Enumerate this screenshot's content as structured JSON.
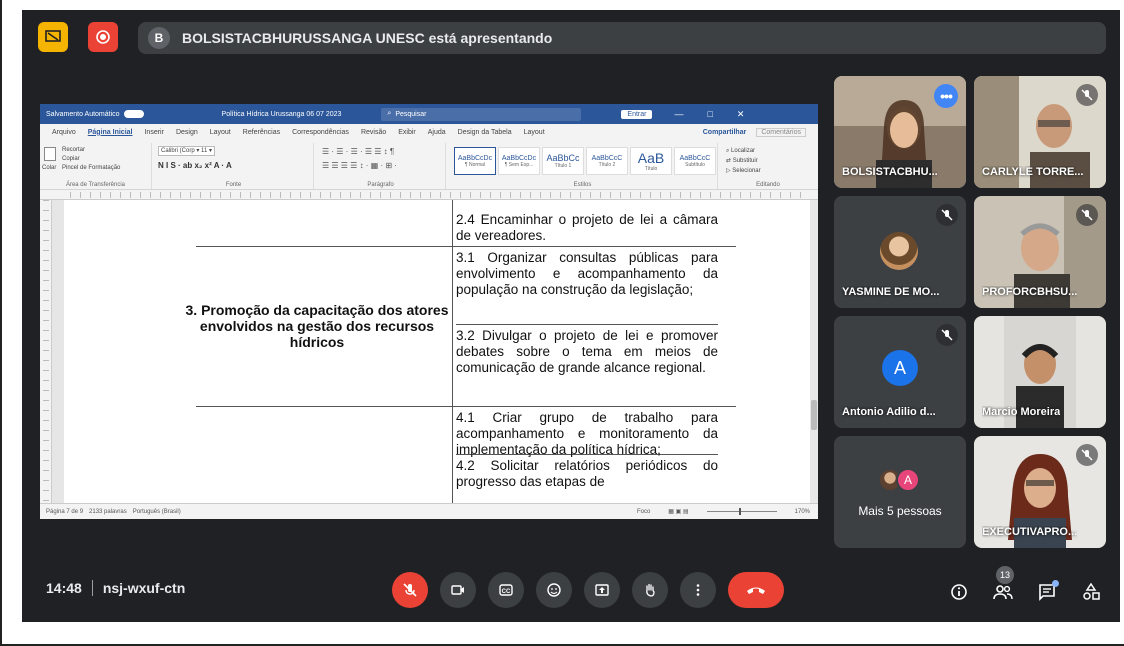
{
  "banner": {
    "avatar_letter": "B",
    "text": "BOLSISTACBHURUSSANGA UNESC está apresentando"
  },
  "word": {
    "autosave": "Salvamento Automático",
    "doc_title": "Política Hídrica Urussanga 06 07 2023",
    "search_placeholder": "Pesquisar",
    "signin": "Entrar",
    "window_controls": [
      "—",
      "□",
      "✕"
    ],
    "tabs": [
      "Arquivo",
      "Página Inicial",
      "Inserir",
      "Design",
      "Layout",
      "Referências",
      "Correspondências",
      "Revisão",
      "Exibir",
      "Ajuda",
      "Design da Tabela",
      "Layout"
    ],
    "share_label": "Compartilhar",
    "comments_label": "Comentários",
    "ribbon": {
      "clipboard": {
        "paste": "Colar",
        "items": [
          "Recortar",
          "Copiar",
          "Pincel de Formatação"
        ],
        "label": "Área de Transferência"
      },
      "font": {
        "name": "Calibri (Corp",
        "size": "11",
        "label": "Fonte",
        "formatting": "N I S · ab x₂ x² A · A"
      },
      "paragraph": {
        "label": "Parágrafo",
        "row1": "☰ · ☰ · ☰ · ☰ ☰ ↕ ¶",
        "row2": "☰ ☰ ☰ ☰ ↕ · ▦ · ⊞ ·"
      },
      "styles": {
        "label": "Estilos",
        "items": [
          {
            "sample": "AaBbCcDc",
            "name": "¶ Normal"
          },
          {
            "sample": "AaBbCcDc",
            "name": "¶ Sem Esp..."
          },
          {
            "sample": "AaBbCc",
            "name": "Título 1"
          },
          {
            "sample": "AaBbCcC",
            "name": "Título 2"
          },
          {
            "sample": "AaB",
            "name": "Título"
          },
          {
            "sample": "AaBbCcC",
            "name": "Subtítulo"
          }
        ]
      },
      "editing": {
        "label": "Editando",
        "items": [
          "Localizar",
          "Substituir",
          "Selecionar"
        ]
      }
    },
    "table": {
      "left_cell": "3. Promoção da capacitação dos atores envolvidos na gestão dos recursos hídricos",
      "items": [
        "2.4 Encaminhar o projeto de lei a câmara de vereadores.",
        "3.1 Organizar consultas públicas para envolvimento e acompanhamento da população na construção da legislação;",
        "3.2 Divulgar o projeto de lei e promover debates sobre o tema em meios de comunicação de grande alcance regional.",
        "4.1 Criar grupo de trabalho para acompanhamento e monitoramento da implementação da política hídrica;",
        "4.2 Solicitar relatórios periódicos do progresso das etapas de"
      ]
    },
    "status": {
      "page": "Página 7 de 9",
      "words": "2133 palavras",
      "language": "Português (Brasil)",
      "focus": "Foco",
      "zoom": "170%"
    }
  },
  "participants": [
    {
      "name": "BOLSISTACBHU...",
      "speaking": true,
      "kind": "video"
    },
    {
      "name": "CARLYLE TORRE...",
      "muted": true,
      "kind": "video"
    },
    {
      "name": "YASMINE DE MO...",
      "muted": true,
      "kind": "photo"
    },
    {
      "name": "PROFORCBHSU...",
      "muted": true,
      "kind": "video"
    },
    {
      "name": "Antonio Adilio d...",
      "muted": true,
      "kind": "letter",
      "letter": "A"
    },
    {
      "name": "Marcio Moreira",
      "kind": "video"
    },
    {
      "name": "Mais 5 pessoas",
      "kind": "more",
      "letter": "A"
    },
    {
      "name": "EXECUTIVAPRO...",
      "muted": true,
      "kind": "video"
    }
  ],
  "meeting": {
    "time": "14:48",
    "code": "nsj-wxuf-ctn",
    "participant_count": "13"
  },
  "colors": {
    "background": "#202124",
    "tile": "#3c4043",
    "danger": "#ea4335",
    "word_blue": "#2b579a",
    "accent": "#8ab4f8"
  }
}
